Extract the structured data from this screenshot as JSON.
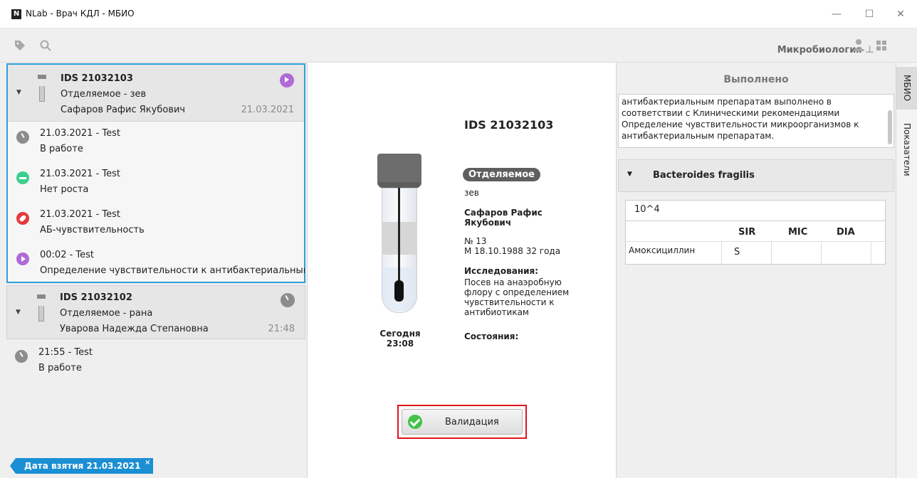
{
  "window": {
    "logo": "N",
    "title": "NLab - Врач КДЛ - МБИО",
    "minimize": "—",
    "maximize": "☐",
    "close": "✕"
  },
  "toolbar": {
    "department": "Микробиология"
  },
  "samples": [
    {
      "ids": "IDS 21032103",
      "material": "Отделяемое  -  зев",
      "patient": "Сафаров Рафис Якубович",
      "date": "21.03.2021",
      "events": [
        {
          "line1": "21.03.2021  -  Test",
          "line2": "В работе",
          "icon": "clock-icon"
        },
        {
          "line1": "21.03.2021  -  Test",
          "line2": "Нет роста",
          "icon": "no-growth-icon"
        },
        {
          "line1": "21.03.2021  -  Test",
          "line2": "АБ-чувствительность",
          "icon": "pill-icon"
        },
        {
          "line1": "00:02  -  Test",
          "line2": "Определение чувствительности к антибактериальным препаратам",
          "icon": "play-icon"
        }
      ]
    },
    {
      "ids": "IDS 21032102",
      "material": "Отделяемое  -  рана",
      "patient": "Уварова Надежда Степановна",
      "date": "21:48",
      "events": [
        {
          "line1": "21:55  -  Test",
          "line2": "В работе",
          "icon": "clock-icon"
        }
      ]
    }
  ],
  "filter_chip": {
    "label": "Дата взятия 21.03.2021",
    "close": "×"
  },
  "detail": {
    "ids": "IDS 21032103",
    "material_badge": "Отделяемое",
    "site": "зев",
    "patient_line1": "Сафаров Рафис",
    "patient_line2": "Якубович",
    "number": "№ 13",
    "demographics": "М  18.10.1988  32 года",
    "studies_label": "Исследования:",
    "studies_lines": [
      "Посев на анаэробную",
      "флору с определением",
      "чувствительности к",
      "антибиотикам"
    ],
    "states_label": "Состояния:",
    "today_label": "Сегодня",
    "today_time": "23:08",
    "validate_label": "Валидация"
  },
  "result": {
    "status": "Выполнено",
    "note_lines": [
      "антибактериальным препаратам выполнено в",
      "соответствии с Клиническими рекомендациями",
      "Определение чувствительности микроорганизмов к",
      "антибактериальным препаратам."
    ],
    "bacteria": "Bacteroides fragilis",
    "titer": "10^4",
    "columns": [
      "SIR",
      "MIC",
      "DIA"
    ],
    "rows": [
      {
        "drug": "Амоксициллин",
        "sir": "S",
        "mic": "",
        "dia": ""
      }
    ]
  },
  "side_tabs": [
    "МБИО",
    "Показатели"
  ],
  "colors": {
    "accent": "#2f9fd6",
    "chip": "#1b8fd3",
    "highlight": "#e0141c"
  }
}
